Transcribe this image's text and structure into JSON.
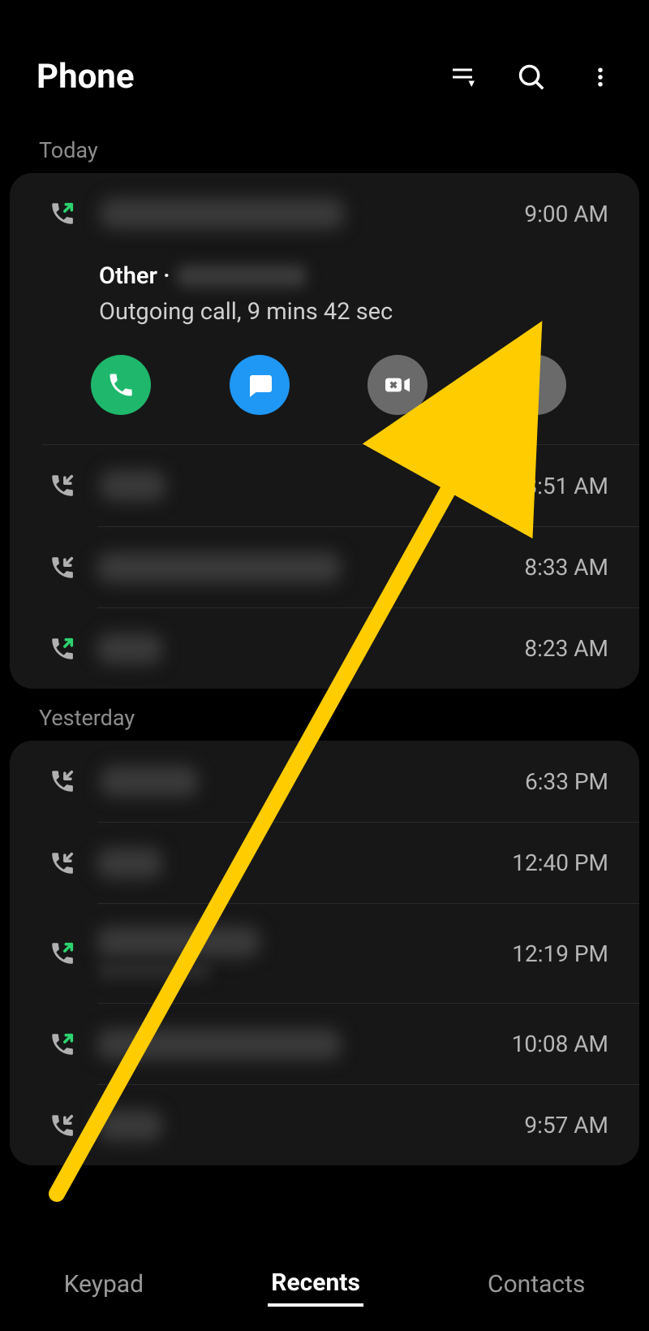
{
  "header": {
    "title": "Phone"
  },
  "sections": {
    "today": {
      "label": "Today",
      "expanded": {
        "time": "9:00 AM",
        "number_prefix": "Other ·",
        "call_info": "Outgoing call, 9 mins 42 sec",
        "call_type": "outgoing"
      },
      "calls": [
        {
          "time": "8:51 AM",
          "type": "incoming"
        },
        {
          "time": "8:33 AM",
          "type": "incoming"
        },
        {
          "time": "8:23 AM",
          "type": "outgoing"
        }
      ]
    },
    "yesterday": {
      "label": "Yesterday",
      "calls": [
        {
          "time": "6:33 PM",
          "type": "incoming"
        },
        {
          "time": "12:40 PM",
          "type": "incoming"
        },
        {
          "time": "12:19 PM",
          "type": "outgoing",
          "has_sub": true
        },
        {
          "time": "10:08 AM",
          "type": "outgoing"
        },
        {
          "time": "9:57 AM",
          "type": "incoming"
        }
      ]
    }
  },
  "nav": {
    "keypad": "Keypad",
    "recents": "Recents",
    "contacts": "Contacts"
  }
}
